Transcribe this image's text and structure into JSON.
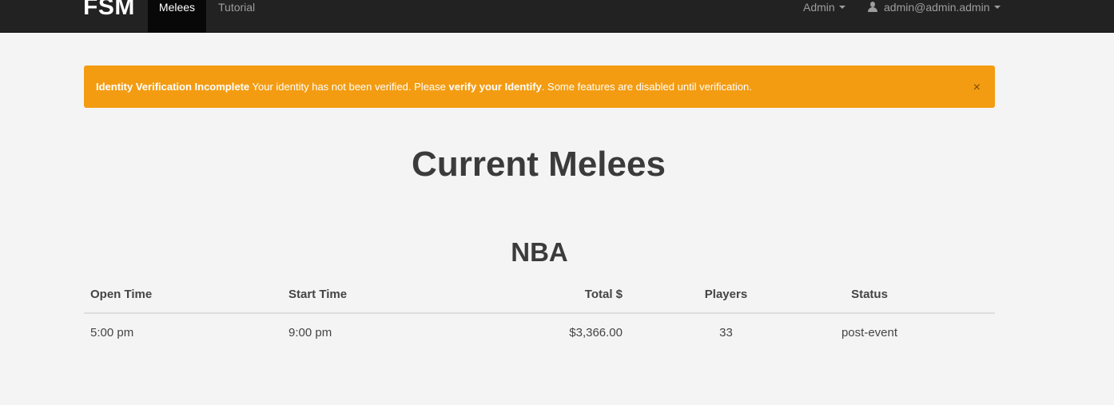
{
  "navbar": {
    "brand": "FSM",
    "links": [
      {
        "label": "Melees",
        "active": true
      },
      {
        "label": "Tutorial",
        "active": false
      }
    ],
    "admin_menu": "Admin",
    "user_menu": "admin@admin.admin"
  },
  "alert": {
    "title": "Identity Verification Incomplete",
    "text_before_link": " Your identity has not been verified. Please ",
    "link_text": "verify your Identify",
    "text_after_link": ". Some features are disabled until verification.",
    "close_glyph": "×",
    "color": "#f39c12"
  },
  "page_title": "Current Melees",
  "sections": [
    {
      "title": "NBA",
      "columns": [
        "Open Time",
        "Start Time",
        "Total $",
        "Players",
        "Status"
      ],
      "rows": [
        {
          "open_time": "5:00 pm",
          "start_time": "9:00 pm",
          "total": "$3,366.00",
          "players": "33",
          "status": "post-event"
        }
      ]
    }
  ],
  "icons": {
    "user": "user-icon",
    "caret": "caret-down-icon",
    "close": "close-icon"
  }
}
